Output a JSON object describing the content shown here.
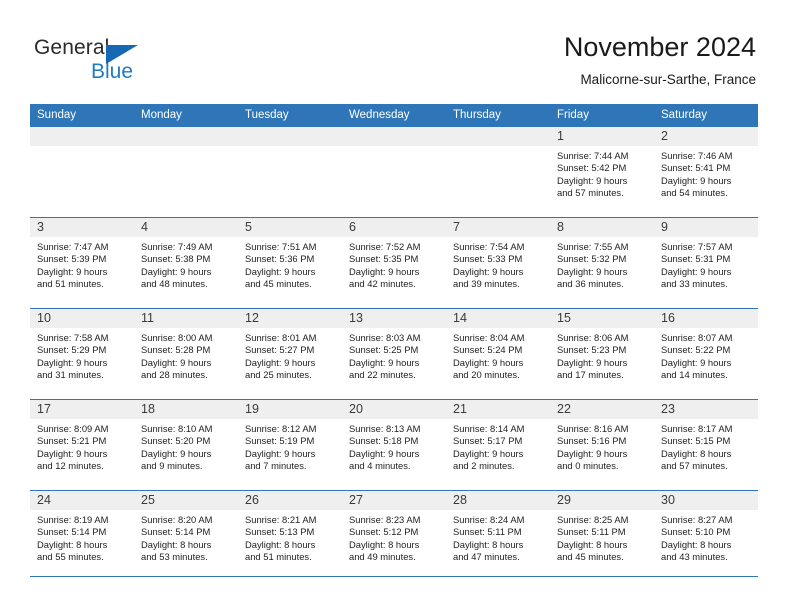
{
  "brand": {
    "name_part1": "General",
    "name_part2": "Blue",
    "logo_icon": "triangle-flag-icon",
    "accent_color": "#1f7bc4"
  },
  "header": {
    "month_title": "November 2024",
    "location": "Malicorne-sur-Sarthe, France"
  },
  "calendar": {
    "header_bg": "#2f76b8",
    "daynum_bg": "#efeff0",
    "weekday_headers": [
      "Sunday",
      "Monday",
      "Tuesday",
      "Wednesday",
      "Thursday",
      "Friday",
      "Saturday"
    ],
    "weeks": [
      [
        {
          "day": "",
          "empty": true
        },
        {
          "day": "",
          "empty": true
        },
        {
          "day": "",
          "empty": true
        },
        {
          "day": "",
          "empty": true
        },
        {
          "day": "",
          "empty": true
        },
        {
          "day": "1",
          "sunrise": "Sunrise: 7:44 AM",
          "sunset": "Sunset: 5:42 PM",
          "daylight_line1": "Daylight: 9 hours",
          "daylight_line2": "and 57 minutes."
        },
        {
          "day": "2",
          "sunrise": "Sunrise: 7:46 AM",
          "sunset": "Sunset: 5:41 PM",
          "daylight_line1": "Daylight: 9 hours",
          "daylight_line2": "and 54 minutes."
        }
      ],
      [
        {
          "day": "3",
          "sunrise": "Sunrise: 7:47 AM",
          "sunset": "Sunset: 5:39 PM",
          "daylight_line1": "Daylight: 9 hours",
          "daylight_line2": "and 51 minutes."
        },
        {
          "day": "4",
          "sunrise": "Sunrise: 7:49 AM",
          "sunset": "Sunset: 5:38 PM",
          "daylight_line1": "Daylight: 9 hours",
          "daylight_line2": "and 48 minutes."
        },
        {
          "day": "5",
          "sunrise": "Sunrise: 7:51 AM",
          "sunset": "Sunset: 5:36 PM",
          "daylight_line1": "Daylight: 9 hours",
          "daylight_line2": "and 45 minutes."
        },
        {
          "day": "6",
          "sunrise": "Sunrise: 7:52 AM",
          "sunset": "Sunset: 5:35 PM",
          "daylight_line1": "Daylight: 9 hours",
          "daylight_line2": "and 42 minutes."
        },
        {
          "day": "7",
          "sunrise": "Sunrise: 7:54 AM",
          "sunset": "Sunset: 5:33 PM",
          "daylight_line1": "Daylight: 9 hours",
          "daylight_line2": "and 39 minutes."
        },
        {
          "day": "8",
          "sunrise": "Sunrise: 7:55 AM",
          "sunset": "Sunset: 5:32 PM",
          "daylight_line1": "Daylight: 9 hours",
          "daylight_line2": "and 36 minutes."
        },
        {
          "day": "9",
          "sunrise": "Sunrise: 7:57 AM",
          "sunset": "Sunset: 5:31 PM",
          "daylight_line1": "Daylight: 9 hours",
          "daylight_line2": "and 33 minutes."
        }
      ],
      [
        {
          "day": "10",
          "sunrise": "Sunrise: 7:58 AM",
          "sunset": "Sunset: 5:29 PM",
          "daylight_line1": "Daylight: 9 hours",
          "daylight_line2": "and 31 minutes."
        },
        {
          "day": "11",
          "sunrise": "Sunrise: 8:00 AM",
          "sunset": "Sunset: 5:28 PM",
          "daylight_line1": "Daylight: 9 hours",
          "daylight_line2": "and 28 minutes."
        },
        {
          "day": "12",
          "sunrise": "Sunrise: 8:01 AM",
          "sunset": "Sunset: 5:27 PM",
          "daylight_line1": "Daylight: 9 hours",
          "daylight_line2": "and 25 minutes."
        },
        {
          "day": "13",
          "sunrise": "Sunrise: 8:03 AM",
          "sunset": "Sunset: 5:25 PM",
          "daylight_line1": "Daylight: 9 hours",
          "daylight_line2": "and 22 minutes."
        },
        {
          "day": "14",
          "sunrise": "Sunrise: 8:04 AM",
          "sunset": "Sunset: 5:24 PM",
          "daylight_line1": "Daylight: 9 hours",
          "daylight_line2": "and 20 minutes."
        },
        {
          "day": "15",
          "sunrise": "Sunrise: 8:06 AM",
          "sunset": "Sunset: 5:23 PM",
          "daylight_line1": "Daylight: 9 hours",
          "daylight_line2": "and 17 minutes."
        },
        {
          "day": "16",
          "sunrise": "Sunrise: 8:07 AM",
          "sunset": "Sunset: 5:22 PM",
          "daylight_line1": "Daylight: 9 hours",
          "daylight_line2": "and 14 minutes."
        }
      ],
      [
        {
          "day": "17",
          "sunrise": "Sunrise: 8:09 AM",
          "sunset": "Sunset: 5:21 PM",
          "daylight_line1": "Daylight: 9 hours",
          "daylight_line2": "and 12 minutes."
        },
        {
          "day": "18",
          "sunrise": "Sunrise: 8:10 AM",
          "sunset": "Sunset: 5:20 PM",
          "daylight_line1": "Daylight: 9 hours",
          "daylight_line2": "and 9 minutes."
        },
        {
          "day": "19",
          "sunrise": "Sunrise: 8:12 AM",
          "sunset": "Sunset: 5:19 PM",
          "daylight_line1": "Daylight: 9 hours",
          "daylight_line2": "and 7 minutes."
        },
        {
          "day": "20",
          "sunrise": "Sunrise: 8:13 AM",
          "sunset": "Sunset: 5:18 PM",
          "daylight_line1": "Daylight: 9 hours",
          "daylight_line2": "and 4 minutes."
        },
        {
          "day": "21",
          "sunrise": "Sunrise: 8:14 AM",
          "sunset": "Sunset: 5:17 PM",
          "daylight_line1": "Daylight: 9 hours",
          "daylight_line2": "and 2 minutes."
        },
        {
          "day": "22",
          "sunrise": "Sunrise: 8:16 AM",
          "sunset": "Sunset: 5:16 PM",
          "daylight_line1": "Daylight: 9 hours",
          "daylight_line2": "and 0 minutes."
        },
        {
          "day": "23",
          "sunrise": "Sunrise: 8:17 AM",
          "sunset": "Sunset: 5:15 PM",
          "daylight_line1": "Daylight: 8 hours",
          "daylight_line2": "and 57 minutes."
        }
      ],
      [
        {
          "day": "24",
          "sunrise": "Sunrise: 8:19 AM",
          "sunset": "Sunset: 5:14 PM",
          "daylight_line1": "Daylight: 8 hours",
          "daylight_line2": "and 55 minutes."
        },
        {
          "day": "25",
          "sunrise": "Sunrise: 8:20 AM",
          "sunset": "Sunset: 5:14 PM",
          "daylight_line1": "Daylight: 8 hours",
          "daylight_line2": "and 53 minutes."
        },
        {
          "day": "26",
          "sunrise": "Sunrise: 8:21 AM",
          "sunset": "Sunset: 5:13 PM",
          "daylight_line1": "Daylight: 8 hours",
          "daylight_line2": "and 51 minutes."
        },
        {
          "day": "27",
          "sunrise": "Sunrise: 8:23 AM",
          "sunset": "Sunset: 5:12 PM",
          "daylight_line1": "Daylight: 8 hours",
          "daylight_line2": "and 49 minutes."
        },
        {
          "day": "28",
          "sunrise": "Sunrise: 8:24 AM",
          "sunset": "Sunset: 5:11 PM",
          "daylight_line1": "Daylight: 8 hours",
          "daylight_line2": "and 47 minutes."
        },
        {
          "day": "29",
          "sunrise": "Sunrise: 8:25 AM",
          "sunset": "Sunset: 5:11 PM",
          "daylight_line1": "Daylight: 8 hours",
          "daylight_line2": "and 45 minutes."
        },
        {
          "day": "30",
          "sunrise": "Sunrise: 8:27 AM",
          "sunset": "Sunset: 5:10 PM",
          "daylight_line1": "Daylight: 8 hours",
          "daylight_line2": "and 43 minutes."
        }
      ]
    ]
  }
}
